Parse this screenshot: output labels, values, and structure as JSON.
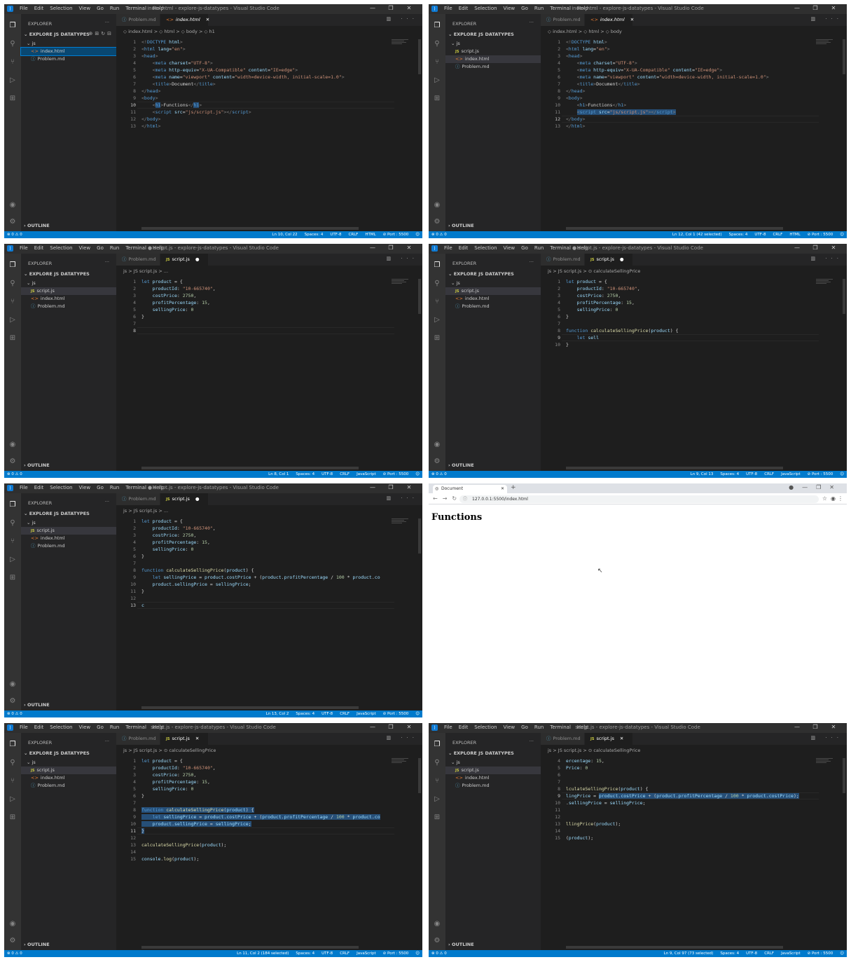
{
  "menu": [
    "File",
    "Edit",
    "Selection",
    "View",
    "Go",
    "Run",
    "Terminal",
    "Help"
  ],
  "window_controls": [
    "—",
    "❐",
    "✕"
  ],
  "sidebar": {
    "header": "EXPLORER",
    "dots": "···",
    "project": "EXPLORE JS DATATYPES",
    "folder": "js",
    "file_script": "script.js",
    "file_index": "index.html",
    "file_problem": "Problem.md",
    "outline": "OUTLINE"
  },
  "panels": [
    {
      "title": "index.html - explore-js-datatypes - Visual Studio Code",
      "tab1": "Problem.md",
      "tab2": "index.html",
      "tab2_icon": "html",
      "tab2_mark": "✕",
      "bread": "◇ index.html > ◇ html > ◇ body > ◇ h1",
      "show_script": false,
      "sel": "index",
      "status_right": [
        "Ln 10, Col 22",
        "Spaces: 4",
        "UTF-8",
        "CRLF",
        "HTML",
        "⊘ Port : 5500"
      ],
      "code": [
        {
          "n": "1",
          "h": "<span class='pu'>&lt;!</span><span class='tg'>DOCTYPE</span> <span class='at'>html</span><span class='pu'>&gt;</span>"
        },
        {
          "n": "2",
          "h": "<span class='pu'>&lt;</span><span class='tg'>html</span> <span class='at'>lang</span>=<span class='sv'>\"en\"</span><span class='pu'>&gt;</span>"
        },
        {
          "n": "3",
          "h": "<span class='pu'>&lt;</span><span class='tg'>head</span><span class='pu'>&gt;</span>"
        },
        {
          "n": "4",
          "h": "    <span class='pu'>&lt;</span><span class='tg'>meta</span> <span class='at'>charset</span>=<span class='sv'>\"UTF-8\"</span><span class='pu'>&gt;</span>"
        },
        {
          "n": "5",
          "h": "    <span class='pu'>&lt;</span><span class='tg'>meta</span> <span class='at'>http-equiv</span>=<span class='sv'>\"X-UA-Compatible\"</span> <span class='at'>content</span>=<span class='sv'>\"IE=edge\"</span><span class='pu'>&gt;</span>"
        },
        {
          "n": "6",
          "h": "    <span class='pu'>&lt;</span><span class='tg'>meta</span> <span class='at'>name</span>=<span class='sv'>\"viewport\"</span> <span class='at'>content</span>=<span class='sv'>\"width=device-width, initial-scale=1.0\"</span><span class='pu'>&gt;</span>"
        },
        {
          "n": "7",
          "h": "    <span class='pu'>&lt;</span><span class='tg'>title</span><span class='pu'>&gt;</span>Document<span class='pu'>&lt;/</span><span class='tg'>title</span><span class='pu'>&gt;</span>"
        },
        {
          "n": "8",
          "h": "<span class='pu'>&lt;/</span><span class='tg'>head</span><span class='pu'>&gt;</span>"
        },
        {
          "n": "9",
          "h": "<span class='pu'>&lt;</span><span class='tg'>body</span><span class='pu'>&gt;</span>"
        },
        {
          "n": "10",
          "h": "    <span class='pu'>&lt;</span><span class='tg sel-bg'>h1</span><span class='pu'>&gt;</span>Functions<span class='pu'>&lt;/</span><span class='tg sel-bg'>h1</span><span class='pu'>&gt;</span>",
          "cur": true
        },
        {
          "n": "11",
          "h": "    <span class='pu'>&lt;</span><span class='tg'>script</span> <span class='at'>src</span>=<span class='sv'>\"js/script.js\"</span><span class='pu'>&gt;&lt;/</span><span class='tg'>script</span><span class='pu'>&gt;</span>"
        },
        {
          "n": "12",
          "h": "<span class='pu'>&lt;/</span><span class='tg'>body</span><span class='pu'>&gt;</span>"
        },
        {
          "n": "13",
          "h": "<span class='pu'>&lt;/</span><span class='tg'>html</span><span class='pu'>&gt;</span>"
        }
      ]
    },
    {
      "title": "index.html - explore-js-datatypes - Visual Studio Code",
      "tab1": "Problem.md",
      "tab2": "index.html",
      "tab2_icon": "html",
      "tab2_mark": "✕",
      "bread": "◇ index.html > ◇ html > ◇ body",
      "show_script": true,
      "sel": "index",
      "status_right": [
        "Ln 12, Col 1 (42 selected)",
        "Spaces: 4",
        "UTF-8",
        "CRLF",
        "HTML",
        "⊘ Port : 5500"
      ],
      "code": [
        {
          "n": "1",
          "h": "<span class='pu'>&lt;!</span><span class='tg'>DOCTYPE</span> <span class='at'>html</span><span class='pu'>&gt;</span>"
        },
        {
          "n": "2",
          "h": "<span class='pu'>&lt;</span><span class='tg'>html</span> <span class='at'>lang</span>=<span class='sv'>\"en\"</span><span class='pu'>&gt;</span>"
        },
        {
          "n": "3",
          "h": "<span class='pu'>&lt;</span><span class='tg'>head</span><span class='pu'>&gt;</span>"
        },
        {
          "n": "4",
          "h": "    <span class='pu'>&lt;</span><span class='tg'>meta</span> <span class='at'>charset</span>=<span class='sv'>\"UTF-8\"</span><span class='pu'>&gt;</span>"
        },
        {
          "n": "5",
          "h": "    <span class='pu'>&lt;</span><span class='tg'>meta</span> <span class='at'>http-equiv</span>=<span class='sv'>\"X-UA-Compatible\"</span> <span class='at'>content</span>=<span class='sv'>\"IE=edge\"</span><span class='pu'>&gt;</span>"
        },
        {
          "n": "6",
          "h": "    <span class='pu'>&lt;</span><span class='tg'>meta</span> <span class='at'>name</span>=<span class='sv'>\"viewport\"</span> <span class='at'>content</span>=<span class='sv'>\"width=device-width, initial-scale=1.0\"</span><span class='pu'>&gt;</span>"
        },
        {
          "n": "7",
          "h": "    <span class='pu'>&lt;</span><span class='tg'>title</span><span class='pu'>&gt;</span>Document<span class='pu'>&lt;/</span><span class='tg'>title</span><span class='pu'>&gt;</span>"
        },
        {
          "n": "8",
          "h": "<span class='pu'>&lt;/</span><span class='tg'>head</span><span class='pu'>&gt;</span>"
        },
        {
          "n": "9",
          "h": "<span class='pu'>&lt;</span><span class='tg'>body</span><span class='pu'>&gt;</span>"
        },
        {
          "n": "10",
          "h": "    <span class='pu'>&lt;</span><span class='tg'>h1</span><span class='pu'>&gt;</span>Functions<span class='pu'>&lt;/</span><span class='tg'>h1</span><span class='pu'>&gt;</span>"
        },
        {
          "n": "11",
          "h": "    <span class='sel-bg'><span class='pu'>&lt;</span><span class='tg'>script</span> <span class='at'>src</span>=<span class='sv'>\"js/script.js\"</span><span class='pu'>&gt;&lt;/</span><span class='tg'>script</span><span class='pu'>&gt;</span></span>"
        },
        {
          "n": "12",
          "h": "<span class='pu'>&lt;/</span><span class='tg'>body</span><span class='pu'>&gt;</span>",
          "cur": true
        },
        {
          "n": "13",
          "h": "<span class='pu'>&lt;/</span><span class='tg'>html</span><span class='pu'>&gt;</span>"
        }
      ]
    },
    {
      "title": "● script.js - explore-js-datatypes - Visual Studio Code",
      "tab1": "Problem.md",
      "tab2": "script.js",
      "tab2_icon": "js",
      "tab2_mark": "●",
      "bread": "js > JS script.js > ...",
      "show_script": true,
      "sel": "script",
      "status_right": [
        "Ln 8, Col 1",
        "Spaces: 4",
        "UTF-8",
        "CRLF",
        "JavaScript",
        "⊘ Port : 5500"
      ],
      "code": [
        {
          "n": "1",
          "h": "<span class='kw'>let</span> <span class='pr'>product</span> = {"
        },
        {
          "n": "2",
          "h": "    <span class='pr'>productId</span>: <span class='sv'>\"10-665740\"</span>,"
        },
        {
          "n": "3",
          "h": "    <span class='pr'>costPrice</span>: <span class='nm'>2750</span>,"
        },
        {
          "n": "4",
          "h": "    <span class='pr'>profitPercentage</span>: <span class='nm'>15</span>,"
        },
        {
          "n": "5",
          "h": "    <span class='pr'>sellingPrice</span>: <span class='nm'>0</span>"
        },
        {
          "n": "6",
          "h": "}"
        },
        {
          "n": "7",
          "h": ""
        },
        {
          "n": "8",
          "h": "",
          "cur": true
        }
      ]
    },
    {
      "title": "● script.js - explore-js-datatypes - Visual Studio Code",
      "tab1": "Problem.md",
      "tab2": "script.js",
      "tab2_icon": "js",
      "tab2_mark": "●",
      "bread": "js > JS script.js > ⊙ calculateSellingPrice",
      "show_script": true,
      "sel": "script",
      "status_right": [
        "Ln 9, Col 13",
        "Spaces: 4",
        "UTF-8",
        "CRLF",
        "JavaScript",
        "⊘ Port : 5500"
      ],
      "code": [
        {
          "n": "1",
          "h": "<span class='kw'>let</span> <span class='pr'>product</span> = {"
        },
        {
          "n": "2",
          "h": "    <span class='pr'>productId</span>: <span class='sv'>\"10-665740\"</span>,"
        },
        {
          "n": "3",
          "h": "    <span class='pr'>costPrice</span>: <span class='nm'>2750</span>,"
        },
        {
          "n": "4",
          "h": "    <span class='pr'>profitPercentage</span>: <span class='nm'>15</span>,"
        },
        {
          "n": "5",
          "h": "    <span class='pr'>sellingPrice</span>: <span class='nm'>0</span>"
        },
        {
          "n": "6",
          "h": "}"
        },
        {
          "n": "7",
          "h": ""
        },
        {
          "n": "8",
          "h": "<span class='kw'>function</span> <span class='fn'>calculateSellingPrice</span>(<span class='pr'>product</span>) {"
        },
        {
          "n": "9",
          "h": "    <span class='kw'>let</span> <span class='pr'>sell</span>",
          "cur": true
        },
        {
          "n": "10",
          "h": "}"
        }
      ]
    },
    {
      "title": "● script.js - explore-js-datatypes - Visual Studio Code",
      "tab1": "Problem.md",
      "tab2": "script.js",
      "tab2_icon": "js",
      "tab2_mark": "●",
      "bread": "js > JS script.js > ...",
      "show_script": true,
      "sel": "script",
      "status_right": [
        "Ln 13, Col 2",
        "Spaces: 4",
        "UTF-8",
        "CRLF",
        "JavaScript",
        "⊘ Port : 5500"
      ],
      "code": [
        {
          "n": "1",
          "h": "<span class='kw'>let</span> <span class='pr'>product</span> = {"
        },
        {
          "n": "2",
          "h": "    <span class='pr'>productId</span>: <span class='sv'>\"10-665740\"</span>,"
        },
        {
          "n": "3",
          "h": "    <span class='pr'>costPrice</span>: <span class='nm'>2750</span>,"
        },
        {
          "n": "4",
          "h": "    <span class='pr'>profitPercentage</span>: <span class='nm'>15</span>,"
        },
        {
          "n": "5",
          "h": "    <span class='pr'>sellingPrice</span>: <span class='nm'>0</span>"
        },
        {
          "n": "6",
          "h": "}"
        },
        {
          "n": "7",
          "h": ""
        },
        {
          "n": "8",
          "h": "<span class='kw'>function</span> <span class='fn'>calculateSellingPrice</span>(<span class='pr'>product</span>) {"
        },
        {
          "n": "9",
          "h": "    <span class='kw'>let</span> <span class='pr'>sellingPrice</span> = <span class='pr'>product</span>.<span class='pr'>costPrice</span> + (<span class='pr'>product</span>.<span class='pr'>profitPercentage</span> / <span class='nm'>100</span> * <span class='pr'>product</span>.<span class='pr'>co</span>"
        },
        {
          "n": "10",
          "h": "    <span class='pr'>product</span>.<span class='pr'>sellingPrice</span> = <span class='pr'>sellingPrice</span>;"
        },
        {
          "n": "11",
          "h": "}"
        },
        {
          "n": "12",
          "h": ""
        },
        {
          "n": "13",
          "h": "<span class='pr'>c</span>",
          "cur": true
        }
      ]
    },
    {
      "browser": true,
      "tab_title": "Document",
      "url": "127.0.0.1:5500/index.html",
      "heading": "Functions"
    },
    {
      "title": "script.js - explore-js-datatypes - Visual Studio Code",
      "tab1": "Problem.md",
      "tab2": "script.js",
      "tab2_icon": "js",
      "tab2_mark": "✕",
      "bread": "js > JS script.js > ⊙ calculateSellingPrice",
      "show_script": true,
      "sel": "script",
      "status_right": [
        "Ln 11, Col 2 (184 selected)",
        "Spaces: 4",
        "UTF-8",
        "CRLF",
        "JavaScript",
        "⊘ Port : 5500"
      ],
      "code": [
        {
          "n": "1",
          "h": "<span class='kw'>let</span> <span class='pr'>product</span> = {"
        },
        {
          "n": "2",
          "h": "    <span class='pr'>productId</span>: <span class='sv'>\"10-665740\"</span>,"
        },
        {
          "n": "3",
          "h": "    <span class='pr'>costPrice</span>: <span class='nm'>2750</span>,"
        },
        {
          "n": "4",
          "h": "    <span class='pr'>profitPercentage</span>: <span class='nm'>15</span>,"
        },
        {
          "n": "5",
          "h": "    <span class='pr'>sellingPrice</span>: <span class='nm'>0</span>"
        },
        {
          "n": "6",
          "h": "}"
        },
        {
          "n": "7",
          "h": ""
        },
        {
          "n": "8",
          "h": "<span class='sel-bg'><span class='kw'>function</span> <span class='fn'>calculateSellingPrice</span>(<span class='pr'>product</span>) {</span>"
        },
        {
          "n": "9",
          "h": "<span class='sel-bg'>    <span class='kw'>let</span> <span class='pr'>sellingPrice</span> = <span class='pr'>product</span>.<span class='pr'>costPrice</span> + (<span class='pr'>product</span>.<span class='pr'>profitPercentage</span> / <span class='nm'>100</span> * <span class='pr'>product</span>.<span class='pr'>co</span></span>"
        },
        {
          "n": "10",
          "h": "<span class='sel-bg'>    <span class='pr'>product</span>.<span class='pr'>sellingPrice</span> = <span class='pr'>sellingPrice</span>;</span>"
        },
        {
          "n": "11",
          "h": "<span class='sel-bg'>}</span>",
          "cur": true
        },
        {
          "n": "12",
          "h": ""
        },
        {
          "n": "13",
          "h": "<span class='fn'>calculateSellingPrice</span>(<span class='pr'>product</span>);"
        },
        {
          "n": "14",
          "h": ""
        },
        {
          "n": "15",
          "h": "<span class='pr'>console</span>.<span class='fn'>log</span>(<span class='pr'>product</span>);"
        }
      ]
    },
    {
      "title": "script.js - explore-js-datatypes - Visual Studio Code",
      "tab1": "Problem.md",
      "tab2": "script.js",
      "tab2_icon": "js",
      "tab2_mark": "✕",
      "bread": "js > JS script.js > ⊙ calculateSellingPrice",
      "show_script": true,
      "sel": "script",
      "status_right": [
        "Ln 9, Col 97 (73 selected)",
        "Spaces: 4",
        "UTF-8",
        "CRLF",
        "JavaScript",
        "⊘ Port : 5500"
      ],
      "code": [
        {
          "n": "4",
          "h": "<span class='pr'>ercentage</span>: <span class='nm'>15</span>,"
        },
        {
          "n": "5",
          "h": "<span class='pr'>Price</span>: <span class='nm'>0</span>"
        },
        {
          "n": "6",
          "h": ""
        },
        {
          "n": "7",
          "h": ""
        },
        {
          "n": "8",
          "h": "<span class='fn'>lculateSellingPrice</span>(<span class='pr'>product</span>) {"
        },
        {
          "n": "9",
          "h": "<span class='pr'>lingPrice</span> = <span class='sel-bg'><span class='pr'>product</span>.<span class='pr'>costPrice</span> + (<span class='pr'>product</span>.<span class='pr'>profitPercentage</span> / <span class='nm'>100</span> * <span class='pr'>product</span>.<span class='pr'>costPrice</span>);</span>",
          "cur": true
        },
        {
          "n": "10",
          "h": ".<span class='pr'>sellingPrice</span> = <span class='pr'>sellingPrice</span>;"
        },
        {
          "n": "11",
          "h": ""
        },
        {
          "n": "12",
          "h": ""
        },
        {
          "n": "13",
          "h": "<span class='fn'>llingPrice</span>(<span class='pr'>product</span>);"
        },
        {
          "n": "14",
          "h": ""
        },
        {
          "n": "15",
          "h": "(<span class='pr'>product</span>);"
        }
      ]
    }
  ],
  "status_left": "⊗ 0 ⚠ 0",
  "colors": {
    "status": "#007acc",
    "editor": "#1e1e1e",
    "sidebar": "#252526",
    "activity": "#333333"
  }
}
